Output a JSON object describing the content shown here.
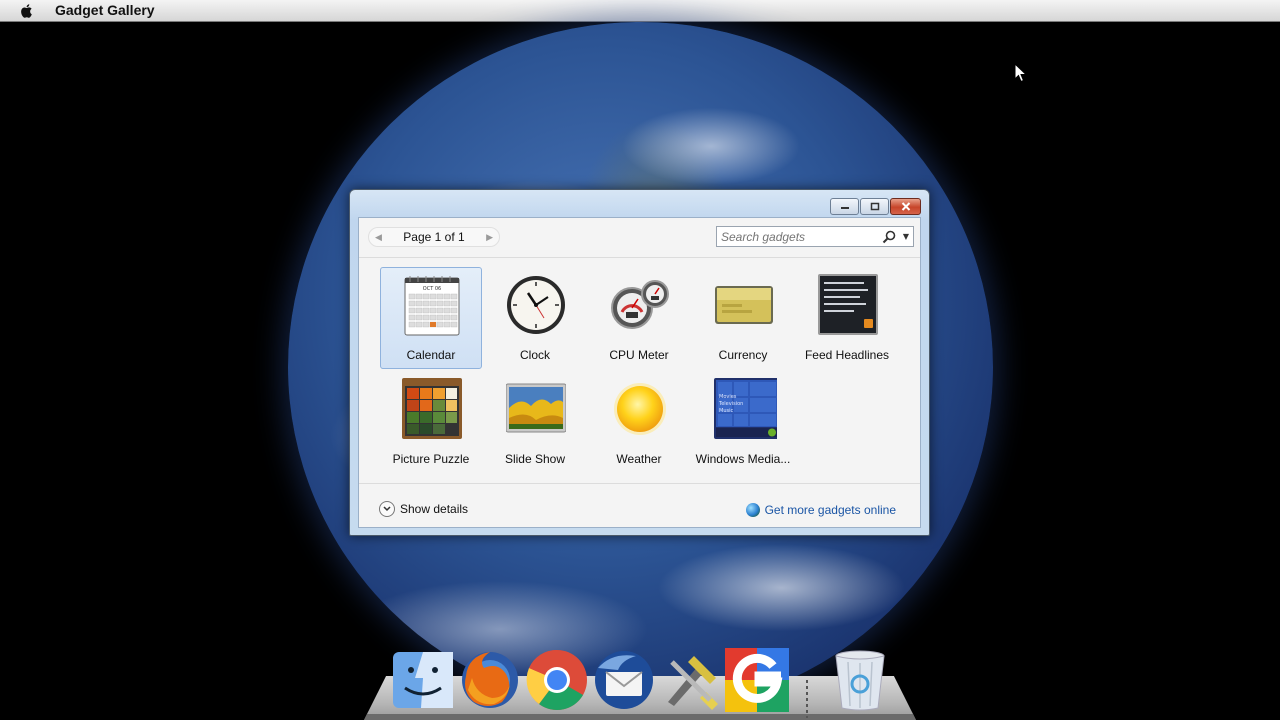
{
  "menubar": {
    "apple_icon": "apple-logo-icon",
    "app_title": "Gadget Gallery"
  },
  "window": {
    "controls": [
      "minimize",
      "maximize",
      "close"
    ],
    "pager": {
      "prev_icon": "triangle-left-icon",
      "text": "Page 1 of 1",
      "next_icon": "triangle-right-icon"
    },
    "search": {
      "placeholder": "Search gadgets",
      "value": ""
    },
    "gadgets": [
      {
        "label": "Calendar",
        "icon": "calendar-gadget-icon",
        "selected": true
      },
      {
        "label": "Clock",
        "icon": "clock-gadget-icon",
        "selected": false
      },
      {
        "label": "CPU Meter",
        "icon": "cpu-meter-gadget-icon",
        "selected": false
      },
      {
        "label": "Currency",
        "icon": "currency-gadget-icon",
        "selected": false
      },
      {
        "label": "Feed Headlines",
        "icon": "feed-headlines-gadget-icon",
        "selected": false
      },
      {
        "label": "Picture Puzzle",
        "icon": "picture-puzzle-gadget-icon",
        "selected": false
      },
      {
        "label": "Slide Show",
        "icon": "slide-show-gadget-icon",
        "selected": false
      },
      {
        "label": "Weather",
        "icon": "weather-gadget-icon",
        "selected": false
      },
      {
        "label": "Windows Media...",
        "icon": "windows-media-gadget-icon",
        "selected": false
      }
    ],
    "calendar_month": "OCT 06",
    "media_lines": [
      "Movies",
      "Television",
      "Music"
    ],
    "show_details": "Show details",
    "get_more": "Get more gadgets online"
  },
  "dock": {
    "items": [
      "finder-icon",
      "firefox-icon",
      "chrome-icon",
      "thunderbird-icon",
      "xcode-tools-icon",
      "google-icon",
      "trash-icon"
    ]
  },
  "colors": {
    "accent_link": "#1a55a5",
    "selection": "#cfe0f4",
    "close_button": "#c7452a"
  }
}
